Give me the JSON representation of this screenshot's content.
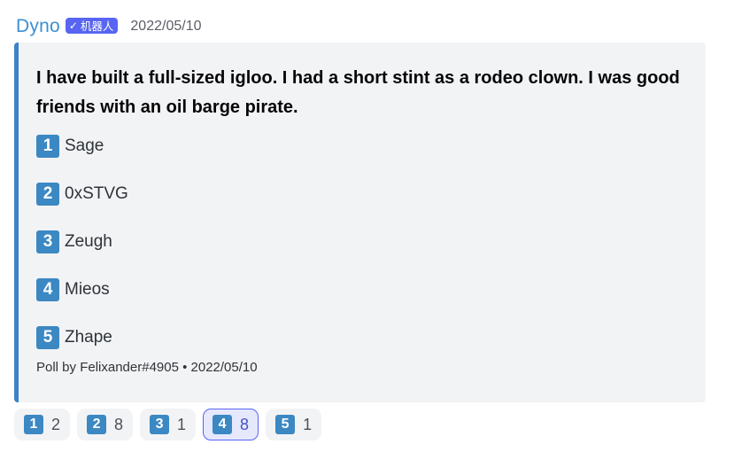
{
  "message": {
    "author": "Dyno",
    "bot_badge": "机器人",
    "timestamp": "2022/05/10"
  },
  "embed": {
    "question": "I have built a full-sized igloo. I had a short stint as a rodeo clown. I was good friends with an oil barge pirate.",
    "options": [
      {
        "number": "1",
        "label": "Sage"
      },
      {
        "number": "2",
        "label": "0xSTVG"
      },
      {
        "number": "3",
        "label": "Zeugh"
      },
      {
        "number": "4",
        "label": "Mieos"
      },
      {
        "number": "5",
        "label": "Zhape"
      }
    ],
    "footer": "Poll by Felixander#4905 • 2022/05/10",
    "accent_color": "#3b82c8"
  },
  "reactions": [
    {
      "number": "1",
      "count": "2",
      "active": false
    },
    {
      "number": "2",
      "count": "8",
      "active": false
    },
    {
      "number": "3",
      "count": "1",
      "active": false
    },
    {
      "number": "4",
      "count": "8",
      "active": true
    },
    {
      "number": "5",
      "count": "1",
      "active": false
    }
  ]
}
